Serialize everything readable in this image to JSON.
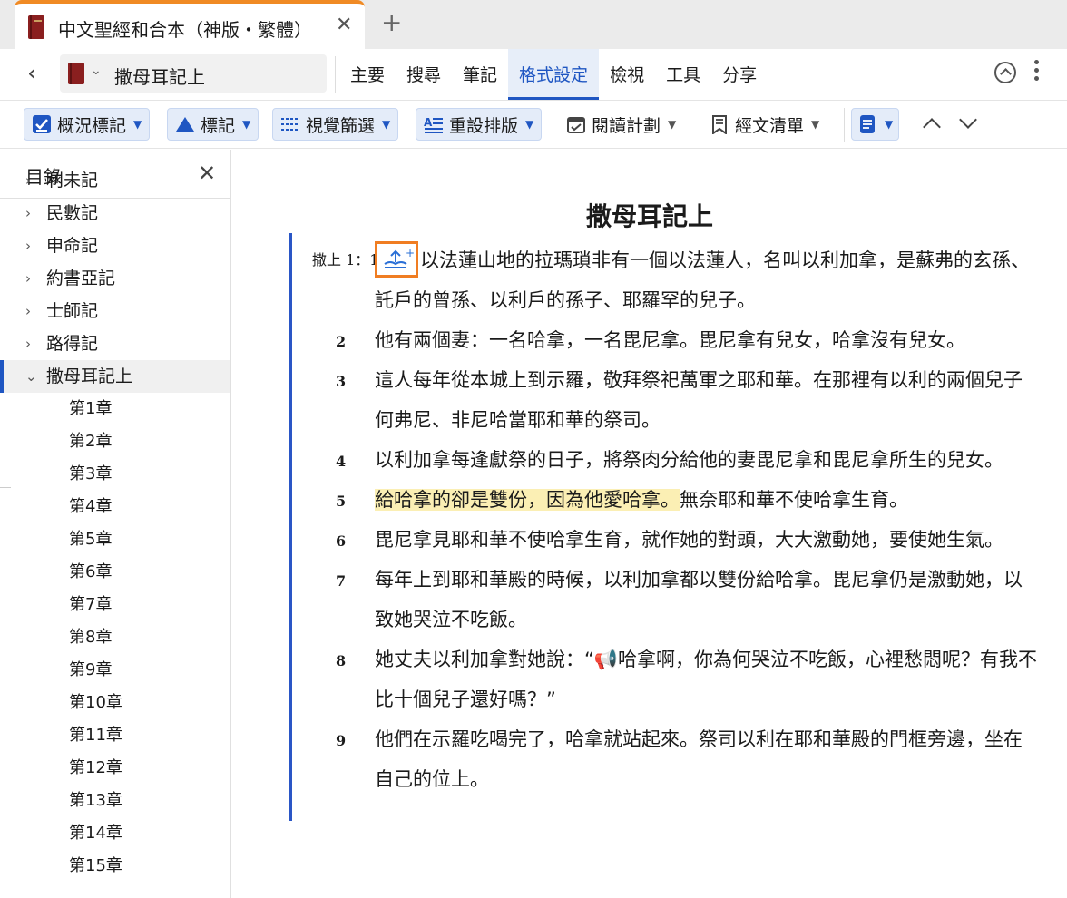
{
  "tab": {
    "title": "中文聖經和合本（神版・繁體）",
    "close": "✕",
    "new_tab": "+"
  },
  "nav": {
    "back": "‹",
    "book_picker_label": "撒母耳記上",
    "menu": [
      "主要",
      "搜尋",
      "筆記",
      "格式設定",
      "檢視",
      "工具",
      "分享"
    ],
    "active_menu": "格式設定"
  },
  "toolbar": {
    "overview_marks": "概況標記",
    "marks": "標記",
    "visual_filter": "視覺篩選",
    "reset_layout": "重設排版",
    "reading_plan": "閱讀計劃",
    "passage_list": "經文清單"
  },
  "sidebar": {
    "title": "目錄",
    "close": "✕",
    "books": [
      "利未記",
      "民數記",
      "申命記",
      "約書亞記",
      "士師記",
      "路得記",
      "撒母耳記上"
    ],
    "active_book": "撒母耳記上",
    "chapters": [
      "第1章",
      "第2章",
      "第3章",
      "第4章",
      "第5章",
      "第6章",
      "第7章",
      "第8章",
      "第9章",
      "第10章",
      "第11章",
      "第12章",
      "第13章",
      "第14章",
      "第15章"
    ]
  },
  "reader": {
    "title": "撒母耳記上",
    "verse1_ref": "撒上 1：1",
    "verses": [
      {
        "n": "",
        "text": "以法蓮山地的拉瑪瑣非有一個以法蓮人，名叫以利加拿，是蘇弗的玄孫、託戶的曾孫、以利戶的孫子、耶羅罕的兒子。"
      },
      {
        "n": "2",
        "text": "他有兩個妻：一名哈拿，一名毘尼拿。毘尼拿有兒女，哈拿沒有兒女。"
      },
      {
        "n": "3",
        "text": "這人每年從本城上到示羅，敬拜祭祀萬軍之耶和華。在那裡有以利的兩個兒子何弗尼、非尼哈當耶和華的祭司。"
      },
      {
        "n": "4",
        "text": "以利加拿每逢獻祭的日子，將祭肉分給他的妻毘尼拿和毘尼拿所生的兒女。"
      },
      {
        "n": "5",
        "hl": "給哈拿的卻是雙份，因為他愛哈拿。",
        "text": "無奈耶和華不使哈拿生育。"
      },
      {
        "n": "6",
        "text": "毘尼拿見耶和華不使哈拿生育，就作她的對頭，大大激動她，要使她生氣。"
      },
      {
        "n": "7",
        "text": "每年上到耶和華殿的時候，以利加拿都以雙份給哈拿。毘尼拿仍是激動她，以致她哭泣不吃飯。"
      },
      {
        "n": "8",
        "text": "她丈夫以利加拿對她說：“📢哈拿啊，你為何哭泣不吃飯，心裡愁悶呢？有我不比十個兒子還好嗎？”"
      },
      {
        "n": "9",
        "text": "他們在示羅吃喝完了，哈拿就站起來。祭司以利在耶和華殿的門框旁邊，坐在自己的位上。"
      }
    ]
  }
}
